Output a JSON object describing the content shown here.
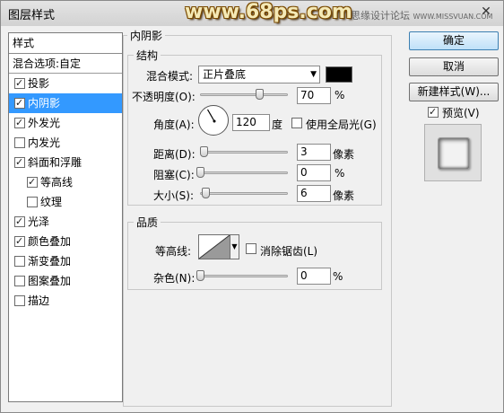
{
  "window": {
    "title": "图层样式",
    "watermark": "www.68ps.com",
    "watermark_right_cn": "思缘设计论坛",
    "watermark_right_url": "WWW.MISSVUAN.COM",
    "close_label": "✕"
  },
  "stylelist": {
    "header": "样式",
    "blend_options": "混合选项:自定",
    "items": [
      {
        "label": "投影",
        "checked": true,
        "sub": false,
        "selected": false
      },
      {
        "label": "内阴影",
        "checked": true,
        "sub": false,
        "selected": true
      },
      {
        "label": "外发光",
        "checked": true,
        "sub": false,
        "selected": false
      },
      {
        "label": "内发光",
        "checked": false,
        "sub": false,
        "selected": false
      },
      {
        "label": "斜面和浮雕",
        "checked": true,
        "sub": false,
        "selected": false
      },
      {
        "label": "等高线",
        "checked": true,
        "sub": true,
        "selected": false
      },
      {
        "label": "纹理",
        "checked": false,
        "sub": true,
        "selected": false
      },
      {
        "label": "光泽",
        "checked": true,
        "sub": false,
        "selected": false
      },
      {
        "label": "颜色叠加",
        "checked": true,
        "sub": false,
        "selected": false
      },
      {
        "label": "渐变叠加",
        "checked": false,
        "sub": false,
        "selected": false
      },
      {
        "label": "图案叠加",
        "checked": false,
        "sub": false,
        "selected": false
      },
      {
        "label": "描边",
        "checked": false,
        "sub": false,
        "selected": false
      }
    ]
  },
  "panel": {
    "title": "内阴影",
    "structure": {
      "title": "结构",
      "blend_mode_label": "混合模式:",
      "blend_mode_value": "正片叠底",
      "blend_color": "#000000",
      "opacity_label": "不透明度(O):",
      "opacity_value": "70",
      "opacity_unit": "%",
      "angle_label": "角度(A):",
      "angle_value": "120",
      "angle_unit": "度",
      "global_light_label": "使用全局光(G)",
      "global_light_checked": false,
      "distance_label": "距离(D):",
      "distance_value": "3",
      "distance_unit": "像素",
      "choke_label": "阻塞(C):",
      "choke_value": "0",
      "choke_unit": "%",
      "size_label": "大小(S):",
      "size_value": "6",
      "size_unit": "像素"
    },
    "quality": {
      "title": "品质",
      "contour_label": "等高线:",
      "antialias_label": "消除锯齿(L)",
      "antialias_checked": false,
      "noise_label": "杂色(N):",
      "noise_value": "0",
      "noise_unit": "%"
    }
  },
  "buttons": {
    "ok": "确定",
    "cancel": "取消",
    "new_style": "新建样式(W)...",
    "preview_label": "预览(V)",
    "preview_checked": true
  }
}
